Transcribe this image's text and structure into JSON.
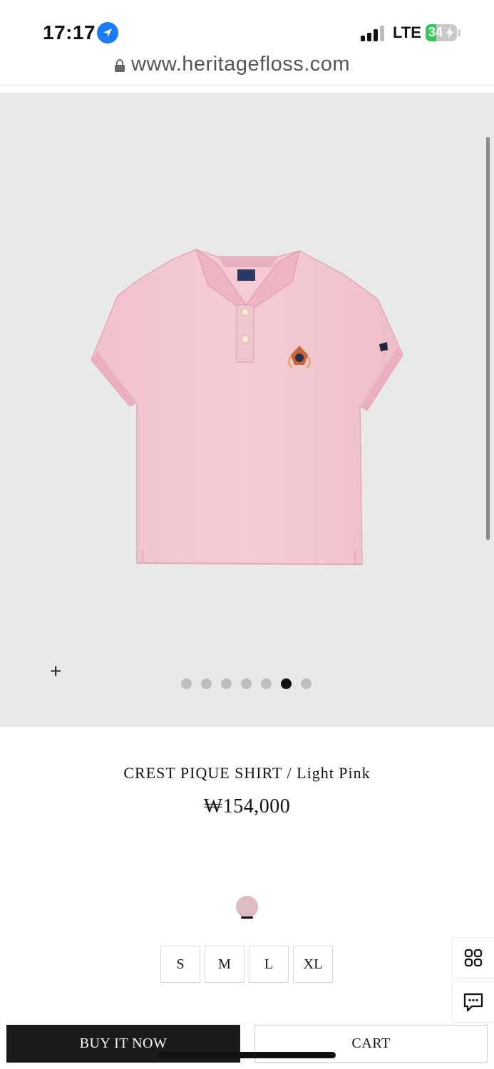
{
  "status_bar": {
    "time": "17:17",
    "network": "LTE",
    "battery": "34",
    "battery_level_pct": 34
  },
  "browser": {
    "url": "www.heritagefloss.com"
  },
  "gallery": {
    "zoom_symbol": "+",
    "image_count": 7,
    "active_index": 5,
    "background": "#e9e9e9"
  },
  "product": {
    "name": "CREST PIQUE SHIRT / Light Pink",
    "price": "₩154,000",
    "swatch_color": "#dcbcc0",
    "shirt_color": "#f2c6cf"
  },
  "sizes": [
    "S",
    "M",
    "L",
    "XL"
  ],
  "side_actions": {
    "grid_icon": "grid-icon",
    "chat_icon": "chat-icon"
  },
  "actions": {
    "buy_now": "BUY IT NOW",
    "cart": "CART"
  }
}
